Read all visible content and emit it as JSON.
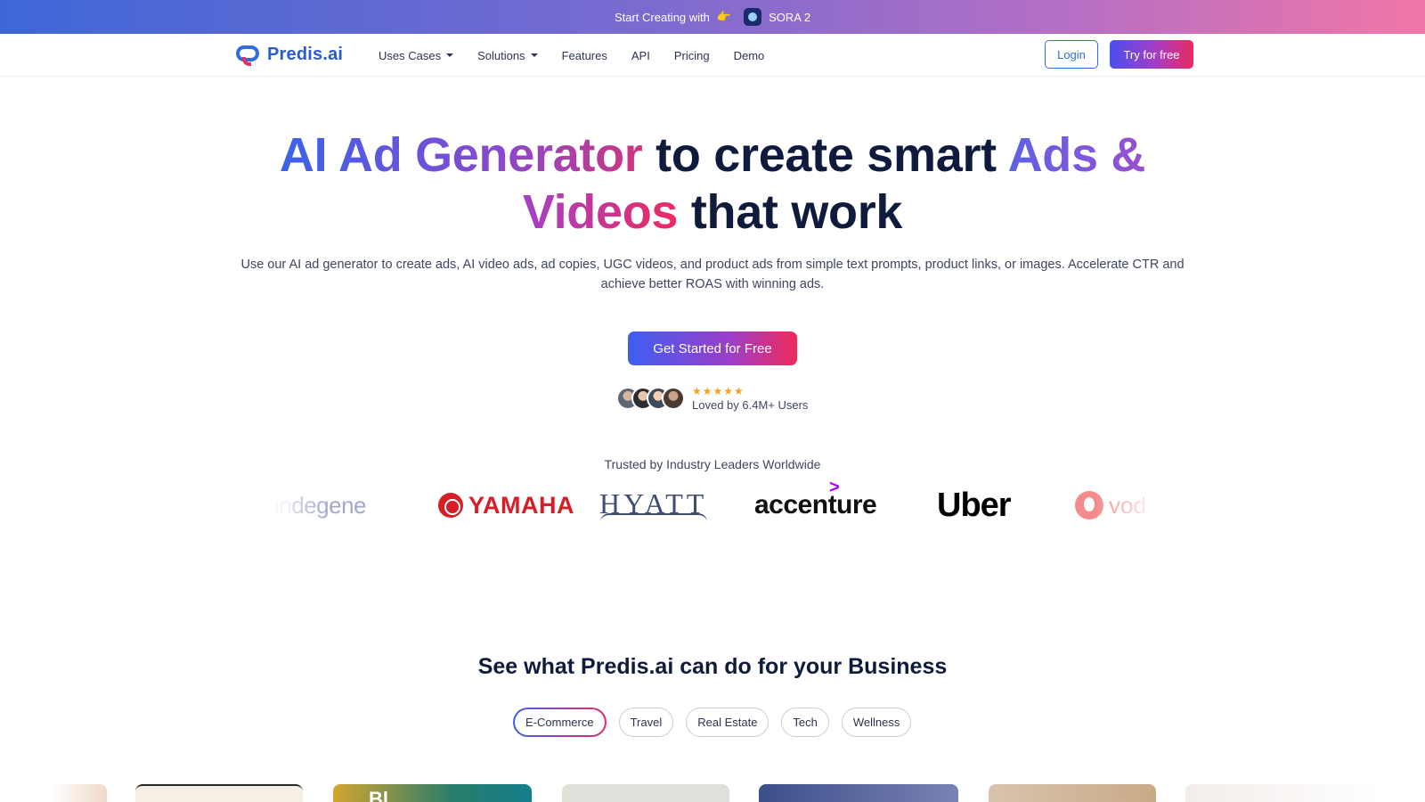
{
  "promo": {
    "text": "Start Creating with",
    "emoji": "👉",
    "product": "SORA 2"
  },
  "nav": {
    "logo_text": "Predis.ai",
    "menu": [
      {
        "label": "Uses Cases",
        "dropdown": true
      },
      {
        "label": "Solutions",
        "dropdown": true
      },
      {
        "label": "Features",
        "dropdown": false
      },
      {
        "label": "API",
        "dropdown": false
      },
      {
        "label": "Pricing",
        "dropdown": false
      },
      {
        "label": "Demo",
        "dropdown": false
      }
    ],
    "login_label": "Login",
    "try_label": "Try for free"
  },
  "hero": {
    "title_grad1": "AI Ad Generator",
    "title_mid": " to create smart ",
    "title_grad2": "Ads &",
    "title_grad3": "Videos",
    "title_end": " that work",
    "subtitle": "Use our AI ad generator to create ads, AI video ads, ad copies, UGC videos, and product ads from simple text prompts, product links, or images. Accelerate CTR and achieve better ROAS with winning ads.",
    "cta_label": "Get Started for Free",
    "rating_stars": "★★★★★",
    "loved_text": "Loved by 6.4M+ Users"
  },
  "trusted": {
    "heading": "Trusted by Industry Leaders Worldwide",
    "logos": {
      "degene_prefix": "in",
      "degene": "degene",
      "yamaha": "YAMAHA",
      "hyatt": "HYATT",
      "accenture": "accenture",
      "uber": "Uber",
      "vodafone": "vod"
    }
  },
  "business": {
    "title": "See what Predis.ai can do for your Business",
    "tabs": [
      "E-Commerce",
      "Travel",
      "Real Estate",
      "Tech",
      "Wellness"
    ],
    "active_tab": "E-Commerce",
    "card_peek_text": "Bl..."
  },
  "colors": {
    "brand_blue": "#2f6de0",
    "gradient_start": "#3e5ef2",
    "gradient_mid": "#9a3fc7",
    "gradient_end": "#ea2a5f",
    "star": "#f4a11b"
  },
  "icons": {
    "logo": "predis-chat-bubble-logo",
    "sora": "sora-app-icon",
    "caret": "chevron-down-icon"
  }
}
